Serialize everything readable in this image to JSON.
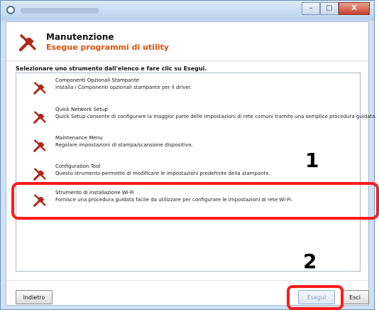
{
  "window": {
    "title": "",
    "controls": {
      "minimize": "–",
      "maximize": "□",
      "close": "X"
    }
  },
  "header": {
    "title": "Manutenzione",
    "subtitle": "Esegue programmi di utility"
  },
  "instruction": "Selezionare uno strumento dall'elenco e fare clic su Esegui.",
  "items": [
    {
      "title": "Componenti Opzionali Stampante",
      "description": "Installa i Componenti opzionali stampante per il driver."
    },
    {
      "title": "Quick Network Setup",
      "description": "Quick Setup consente di configurare la maggior parte delle impostazioni di rete comuni tramite una semplice procedura guidata."
    },
    {
      "title": "Maintenance Menu",
      "description": "Regolare impostazioni di stampa/scansione dispositivo."
    },
    {
      "title": "Configuration Tool",
      "description": "Questo strumento permette di modificare le impostazioni predefinite della stampante."
    },
    {
      "title": "Strumento di installazione Wi-Fi",
      "description": "Fornisce una procedura guidata facile da utilizzare per configurare le impostazioni di rete Wi-Fi."
    }
  ],
  "buttons": {
    "back": "Indietro",
    "run": "Esegui",
    "exit": "Esci"
  },
  "callouts": {
    "step1": "1",
    "step2": "2"
  },
  "colors": {
    "subtitle": "#d9540c",
    "highlight": "#ff1b1b",
    "icon": "#b02818"
  },
  "icons": {
    "tool": "wrench-screwdriver-icon"
  }
}
